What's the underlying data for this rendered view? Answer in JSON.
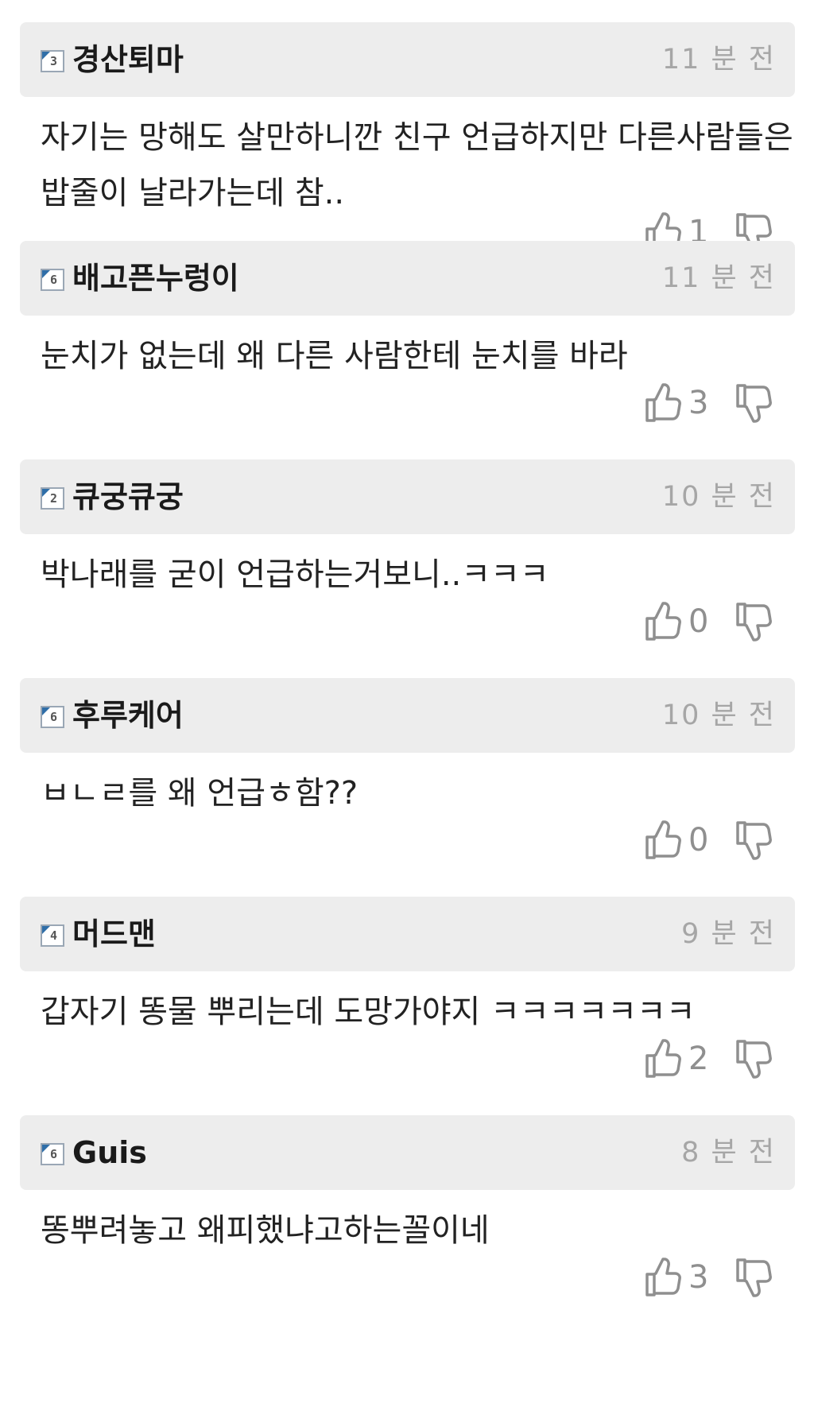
{
  "comments": [
    {
      "level": "3",
      "nickname": "경산퇴마",
      "time": "11 분 전",
      "text": "자기는 망해도 살만하니깐 친구 언급하지만 다른사람들은 밥줄이 날라가는데 참..",
      "likes": "1"
    },
    {
      "level": "6",
      "nickname": "배고픈누렁이",
      "time": "11 분 전",
      "text": "눈치가 없는데 왜 다른 사람한테 눈치를 바라",
      "likes": "3"
    },
    {
      "level": "2",
      "nickname": "큐궁큐궁",
      "time": "10 분 전",
      "text": "박나래를 굳이 언급하는거보니..ㅋㅋㅋ",
      "likes": "0"
    },
    {
      "level": "6",
      "nickname": "후루케어",
      "time": "10 분 전",
      "text": "ㅂㄴㄹ를 왜 언급ㅎ함??",
      "likes": "0"
    },
    {
      "level": "4",
      "nickname": "머드맨",
      "time": "9 분 전",
      "text": "갑자기 똥물 뿌리는데 도망가야지 ㅋㅋㅋㅋㅋㅋㅋ",
      "likes": "2"
    },
    {
      "level": "6",
      "nickname": "Guis",
      "time": "8 분 전",
      "text": "똥뿌려놓고 왜피했냐고하는꼴이네",
      "likes": "3"
    }
  ],
  "icons": {
    "like": "thumbs-up-outline-icon",
    "dislike": "thumbs-down-outline-icon",
    "level": "level-flag-icon"
  },
  "colors": {
    "header_bg": "#ededed",
    "badge_flag": "#2f6ea8",
    "meta_text": "#a6a6a6",
    "vote_icon": "#8f8f8f"
  }
}
